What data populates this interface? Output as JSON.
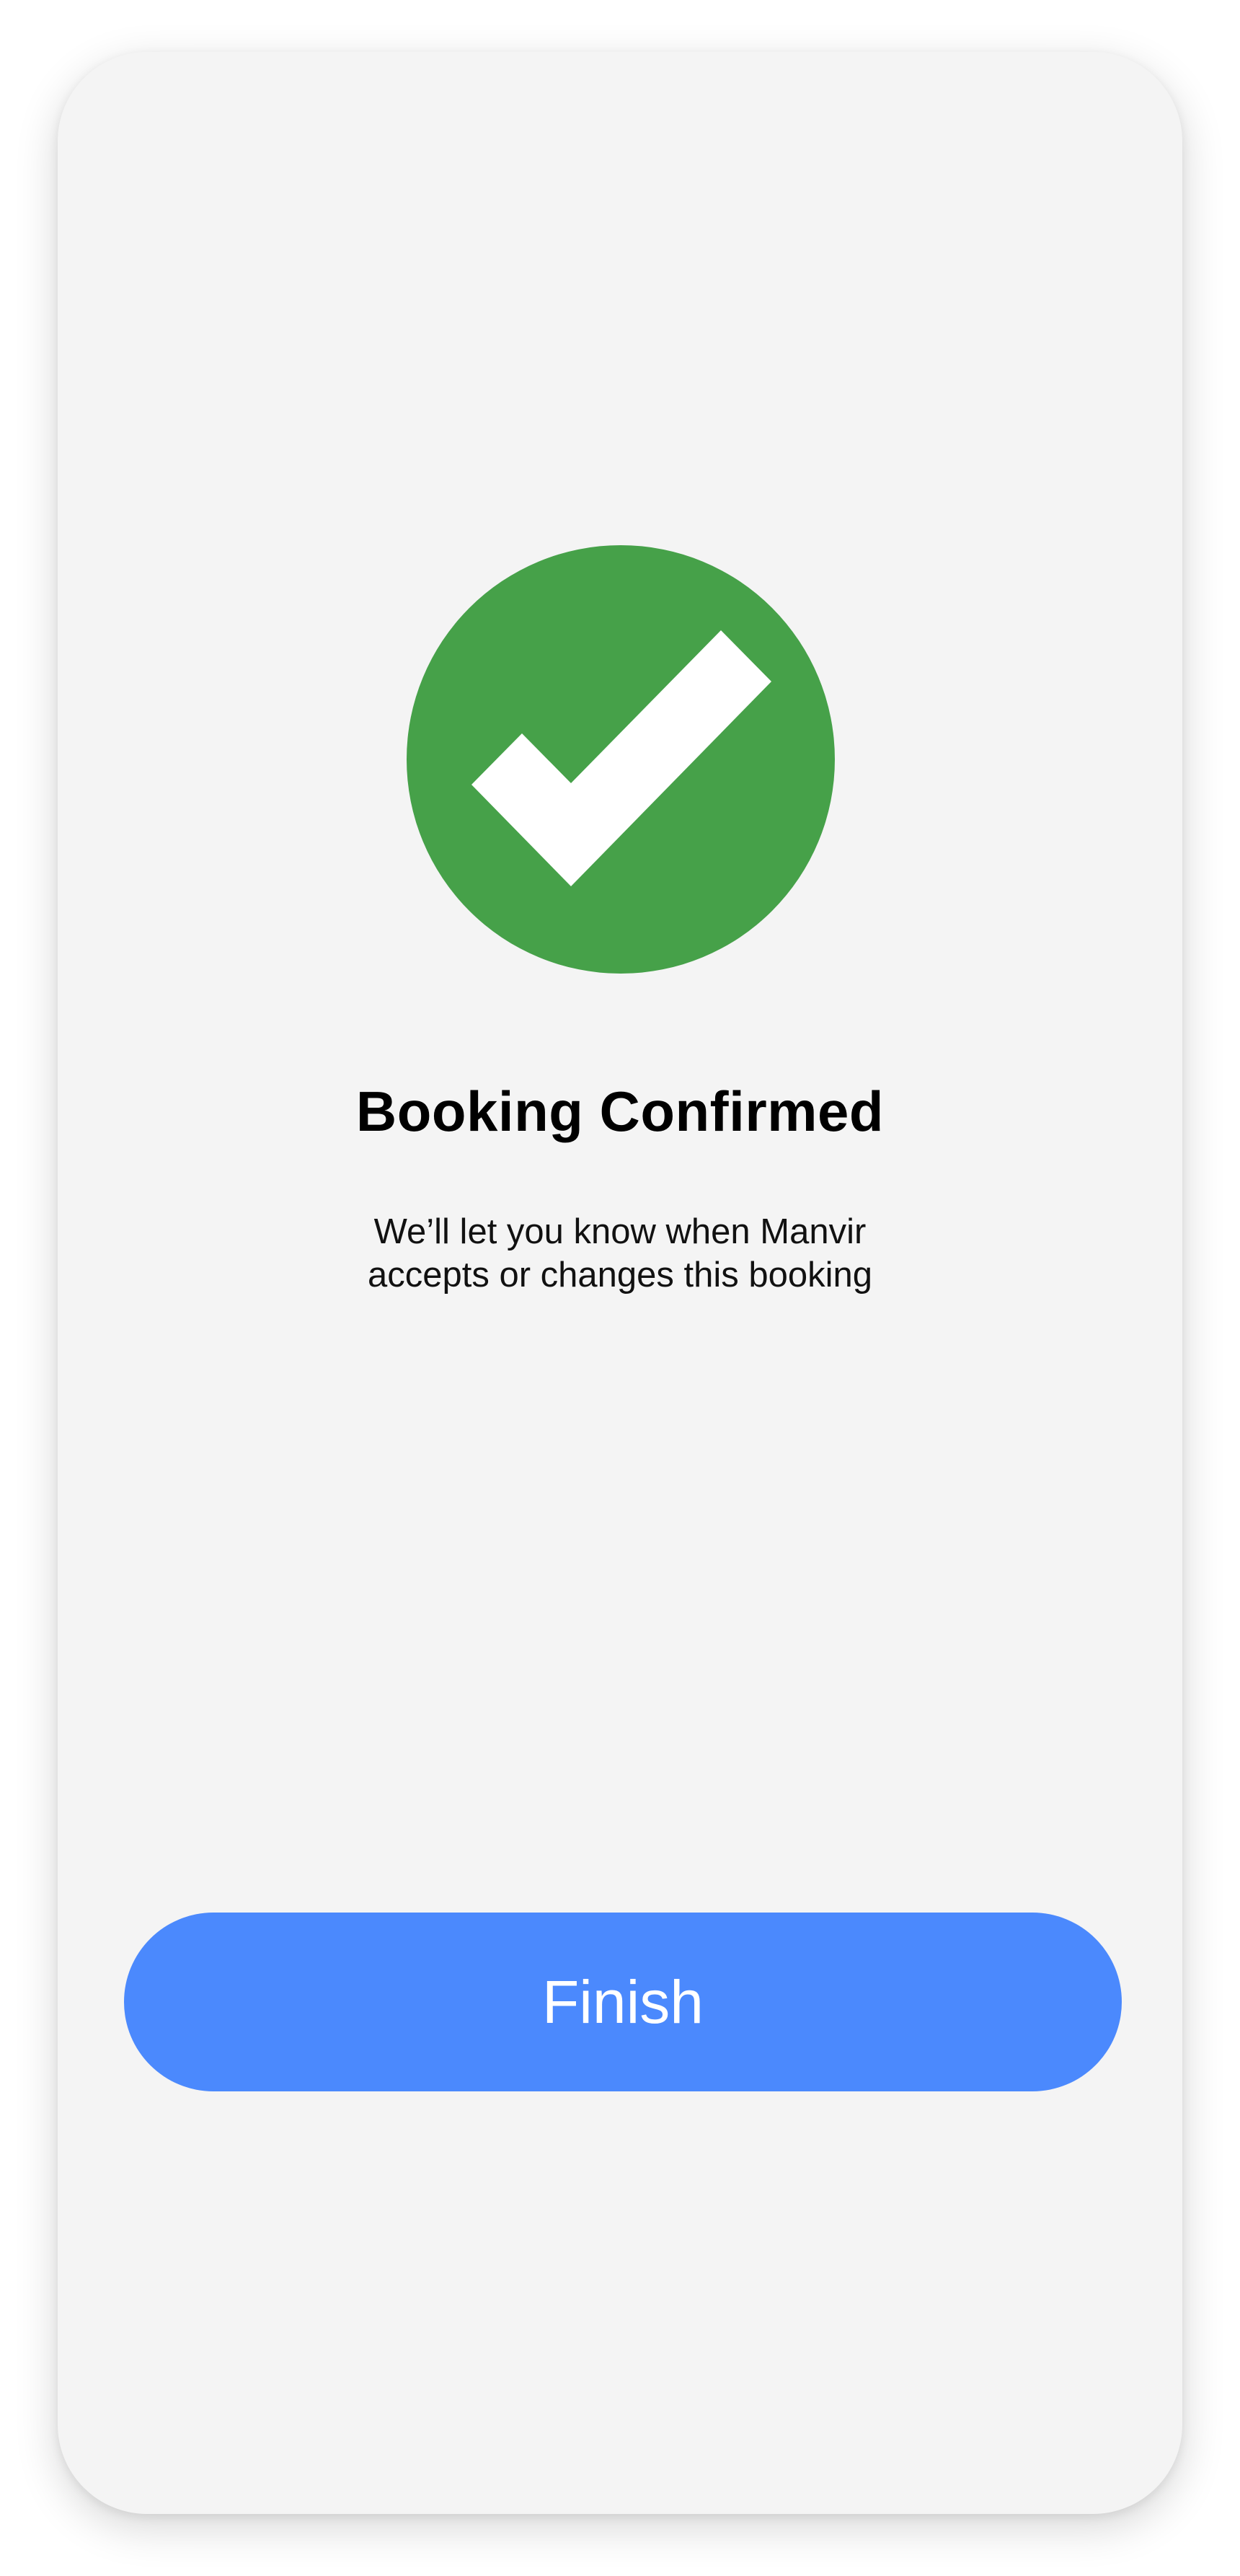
{
  "confirmation": {
    "title": "Booking Confirmed",
    "message": "We’ll let you know when Manvir\naccepts or changes this booking",
    "icon": "check-circle-icon",
    "icon_color": "#46a149"
  },
  "actions": {
    "finish_label": "Finish",
    "button_color": "#4b89fd"
  }
}
